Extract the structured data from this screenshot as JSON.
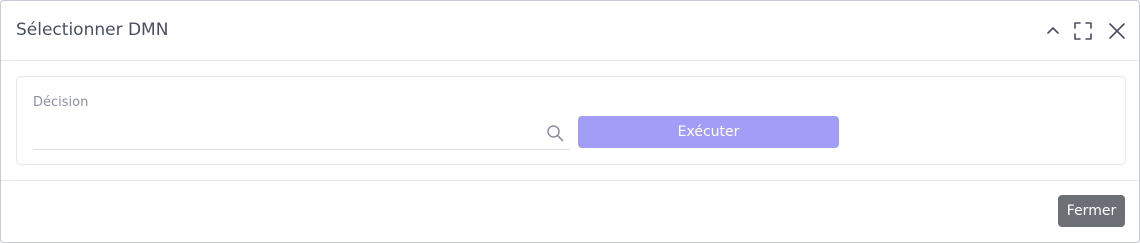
{
  "dialog": {
    "title": "Sélectionner DMN",
    "header_icons": [
      "chevron-up-icon",
      "fullscreen-icon",
      "close-icon"
    ]
  },
  "form": {
    "decision_label": "Décision",
    "decision_value": "",
    "search_icon": "search-icon",
    "execute_label": "Exécuter"
  },
  "footer": {
    "close_label": "Fermer"
  },
  "colors": {
    "accent": "#a29ef8",
    "secondary_button": "#6c7076",
    "title_text": "#4a4e63",
    "label_text": "#8c8fa3"
  }
}
